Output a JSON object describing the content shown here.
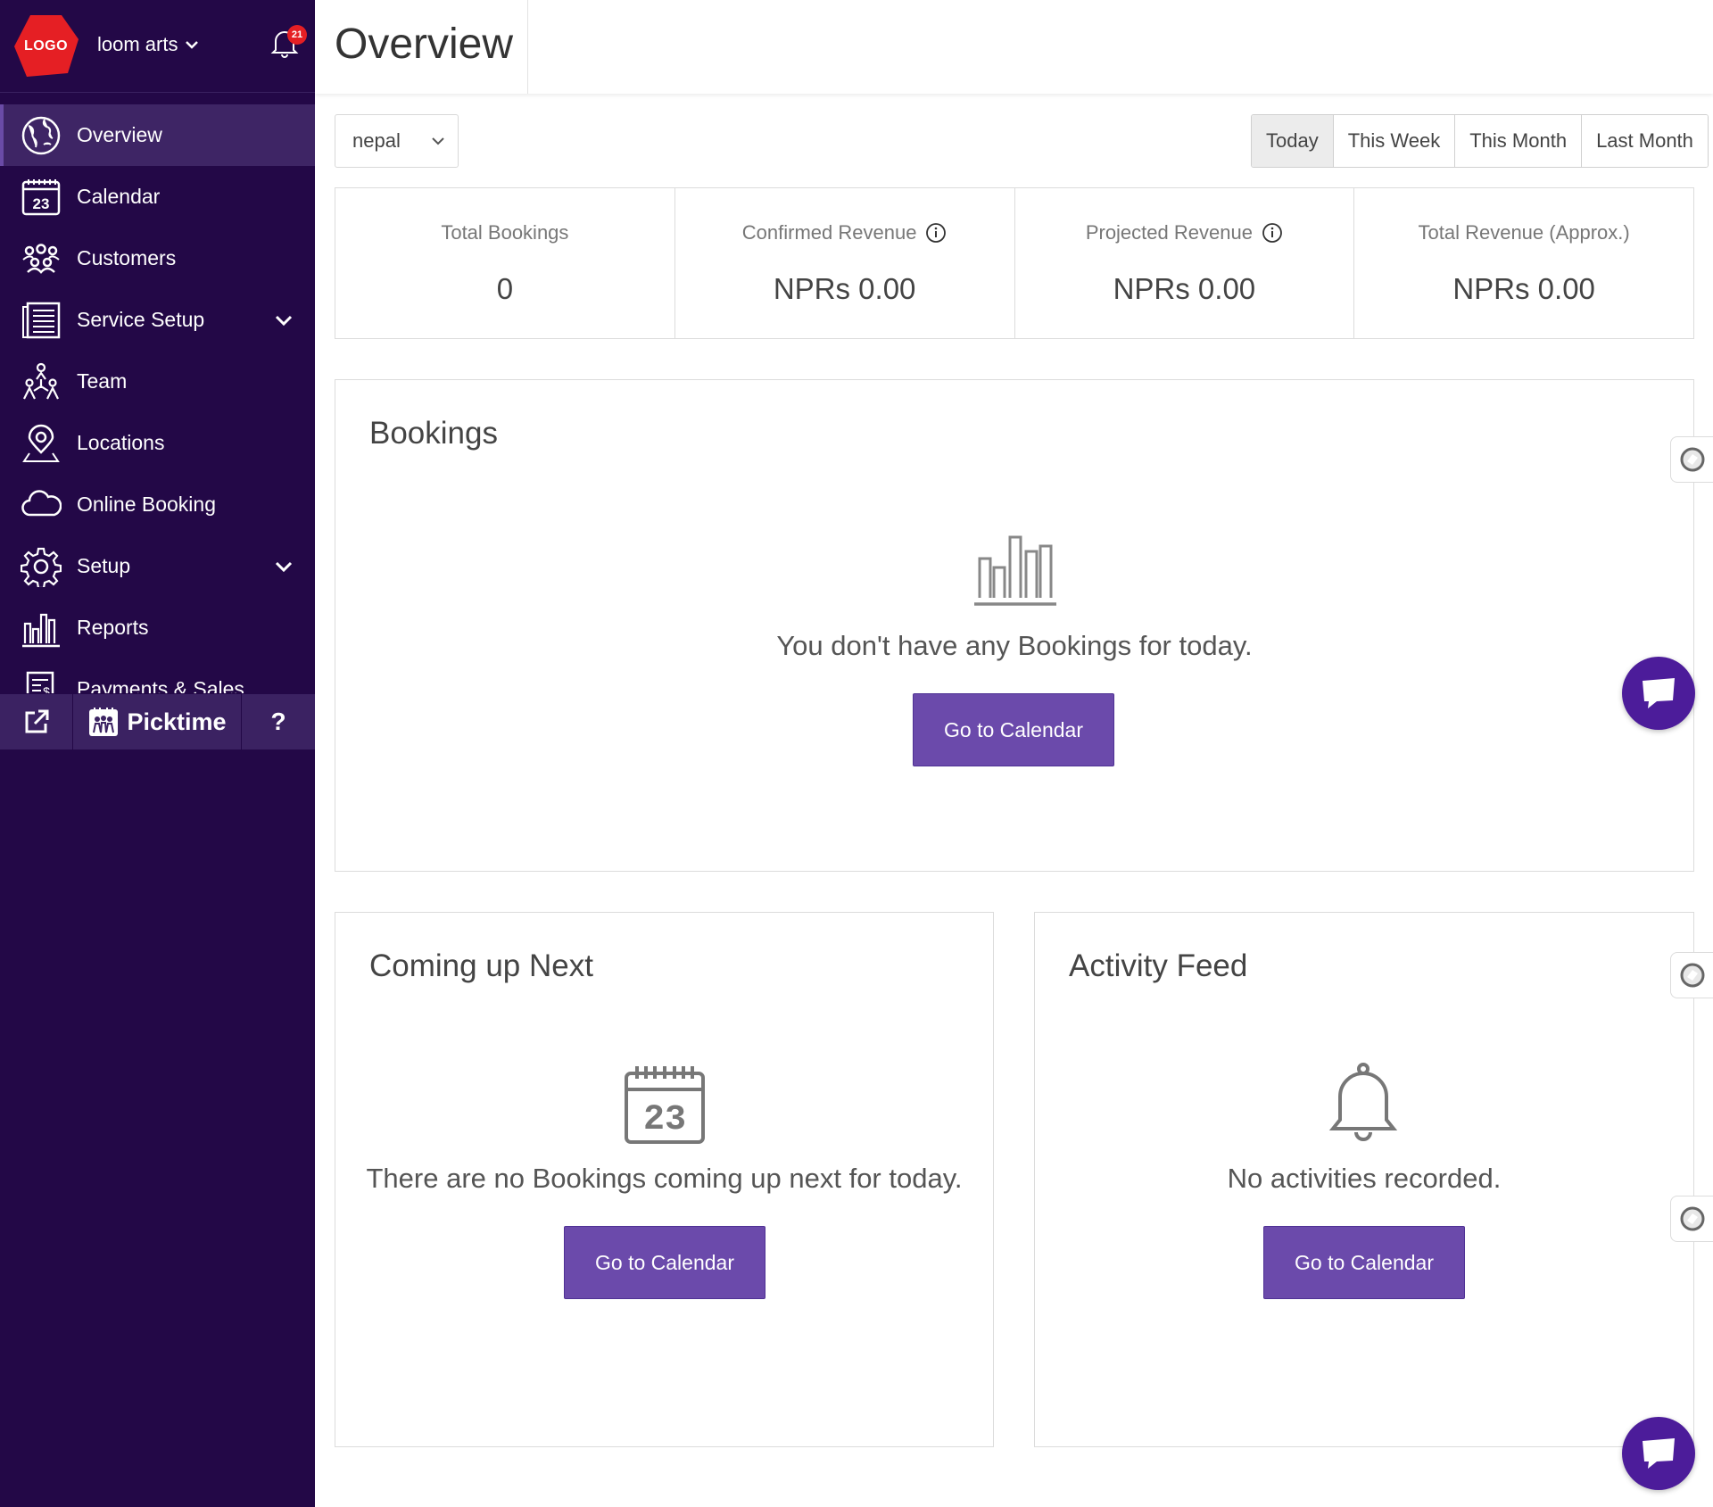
{
  "sidebar": {
    "logo_text": "LOGO",
    "org_name": "loom arts",
    "notification_count": "21",
    "items": [
      {
        "label": "Overview",
        "icon": "globe-icon"
      },
      {
        "label": "Calendar",
        "icon": "calendar-icon"
      },
      {
        "label": "Customers",
        "icon": "customers-icon"
      },
      {
        "label": "Service Setup",
        "icon": "list-icon"
      },
      {
        "label": "Team",
        "icon": "team-icon"
      },
      {
        "label": "Locations",
        "icon": "location-pin-icon"
      },
      {
        "label": "Online Booking",
        "icon": "cloud-icon"
      },
      {
        "label": "Setup",
        "icon": "gear-icon"
      },
      {
        "label": "Reports",
        "icon": "bar-chart-icon"
      },
      {
        "label": "Payments & Sales",
        "icon": "invoice-icon"
      }
    ],
    "brand": "Picktime",
    "help": "?"
  },
  "header": {
    "title": "Overview"
  },
  "filters": {
    "country": "nepal",
    "ranges": [
      "Today",
      "This Week",
      "This Month",
      "Last Month"
    ],
    "active_range": "Today"
  },
  "stats": [
    {
      "label": "Total Bookings",
      "value": "0"
    },
    {
      "label": "Confirmed Revenue",
      "value": "NPRs 0.00"
    },
    {
      "label": "Projected Revenue",
      "value": "NPRs 0.00"
    },
    {
      "label": "Total Revenue (Approx.)",
      "value": "NPRs 0.00"
    }
  ],
  "bookings": {
    "title": "Bookings",
    "empty_text": "You don't have any Bookings for today.",
    "button": "Go to Calendar"
  },
  "up_next": {
    "title": "Coming up Next",
    "empty_text": "There are no Bookings coming up next for today.",
    "button": "Go to Calendar",
    "calendar_day": "23"
  },
  "activity": {
    "title": "Activity Feed",
    "empty_text": "No activities recorded.",
    "button": "Go to Calendar"
  },
  "colors": {
    "sidebar_bg": "#230847",
    "active_item": "#3e2565",
    "accent": "#6b4aab",
    "badge": "#e51f24",
    "chat": "#4c1c9a"
  }
}
